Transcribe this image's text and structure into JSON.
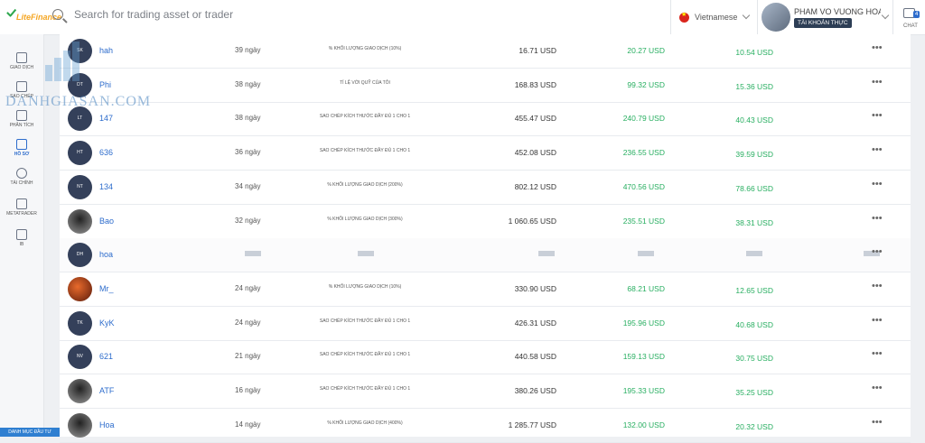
{
  "header": {
    "logo_text": "LiteFinance",
    "search_placeholder": "Search for trading asset or trader",
    "language": "Vietnamese",
    "user_name": "PHAM VO VUONG HOA...",
    "account_badge": "TÀI KHOẢN THỰC",
    "chat_label": "CHAT",
    "chat_count": "4"
  },
  "sidebar": {
    "items": [
      {
        "label": "GIAO DỊCH",
        "icon": "chart-icon"
      },
      {
        "label": "SAO CHÉP",
        "icon": "copy-trader-icon"
      },
      {
        "label": "PHÂN TÍCH",
        "icon": "analytics-icon"
      },
      {
        "label": "HỒ SƠ",
        "icon": "profile-icon"
      },
      {
        "label": "TÀI CHÍNH",
        "icon": "finance-icon"
      },
      {
        "label": "METATRADER",
        "icon": "metatrader-icon"
      },
      {
        "label": "IB",
        "icon": "handshake-icon"
      }
    ],
    "bottom_label": "DANH MỤC ĐẦU TƯ"
  },
  "watermark": "DANHGIASAN.COM",
  "rows": [
    {
      "initials": "SK",
      "name": "hah",
      "days": "39 ngày",
      "strategy": "% KHỐI LƯỢNG GIAO DỊCH (10%)",
      "capital": "16.71 USD",
      "profit": "20.27 USD",
      "fee": "10.54 USD"
    },
    {
      "initials": "DT",
      "name": "Phi",
      "days": "38 ngày",
      "strategy": "TỈ LỆ VỚI QUỸ CỦA TÔI",
      "capital": "168.83 USD",
      "profit": "99.32 USD",
      "fee": "15.36 USD"
    },
    {
      "initials": "LT",
      "name": "147",
      "days": "38 ngày",
      "strategy": "SAO CHÉP KÍCH THƯỚC ĐẦY ĐỦ 1 CHO 1",
      "capital": "455.47 USD",
      "profit": "240.79 USD",
      "fee": "40.43 USD"
    },
    {
      "initials": "HT",
      "name": "636",
      "days": "36 ngày",
      "strategy": "SAO CHÉP KÍCH THƯỚC ĐẦY ĐỦ 1 CHO 1",
      "capital": "452.08 USD",
      "profit": "236.55 USD",
      "fee": "39.59 USD"
    },
    {
      "initials": "NT",
      "name": "134",
      "days": "34 ngày",
      "strategy": "% KHỐI LƯỢNG GIAO DỊCH (200%)",
      "capital": "802.12 USD",
      "profit": "470.56 USD",
      "fee": "78.66 USD"
    },
    {
      "initials": "",
      "name": "Bao",
      "days": "32 ngày",
      "strategy": "% KHỐI LƯỢNG GIAO DỊCH (300%)",
      "capital": "1 060.65 USD",
      "profit": "235.51 USD",
      "fee": "38.31 USD"
    },
    {
      "initials": "DH",
      "name": "hoa",
      "days": "",
      "strategy": "",
      "capital": "",
      "profit": "",
      "fee": ""
    },
    {
      "initials": "",
      "name": "Mr_",
      "days": "24 ngày",
      "strategy": "% KHỐI LƯỢNG GIAO DỊCH (10%)",
      "capital": "330.90 USD",
      "profit": "68.21 USD",
      "fee": "12.65 USD"
    },
    {
      "initials": "TK",
      "name": "KyK",
      "days": "24 ngày",
      "strategy": "SAO CHÉP KÍCH THƯỚC ĐẦY ĐỦ 1 CHO 1",
      "capital": "426.31 USD",
      "profit": "195.96 USD",
      "fee": "40.68 USD"
    },
    {
      "initials": "NV",
      "name": "621",
      "days": "21 ngày",
      "strategy": "SAO CHÉP KÍCH THƯỚC ĐẦY ĐỦ 1 CHO 1",
      "capital": "440.58 USD",
      "profit": "159.13 USD",
      "fee": "30.75 USD"
    },
    {
      "initials": "",
      "name": "ATF",
      "days": "16 ngày",
      "strategy": "SAO CHÉP KÍCH THƯỚC ĐẦY ĐỦ 1 CHO 1",
      "capital": "380.26 USD",
      "profit": "195.33 USD",
      "fee": "35.25 USD"
    },
    {
      "initials": "",
      "name": "Hoa",
      "days": "14 ngày",
      "strategy": "% KHỐI LƯỢNG GIAO DỊCH (400%)",
      "capital": "1 285.77 USD",
      "profit": "132.00 USD",
      "fee": "20.32 USD"
    }
  ],
  "menu_glyph": "•••"
}
